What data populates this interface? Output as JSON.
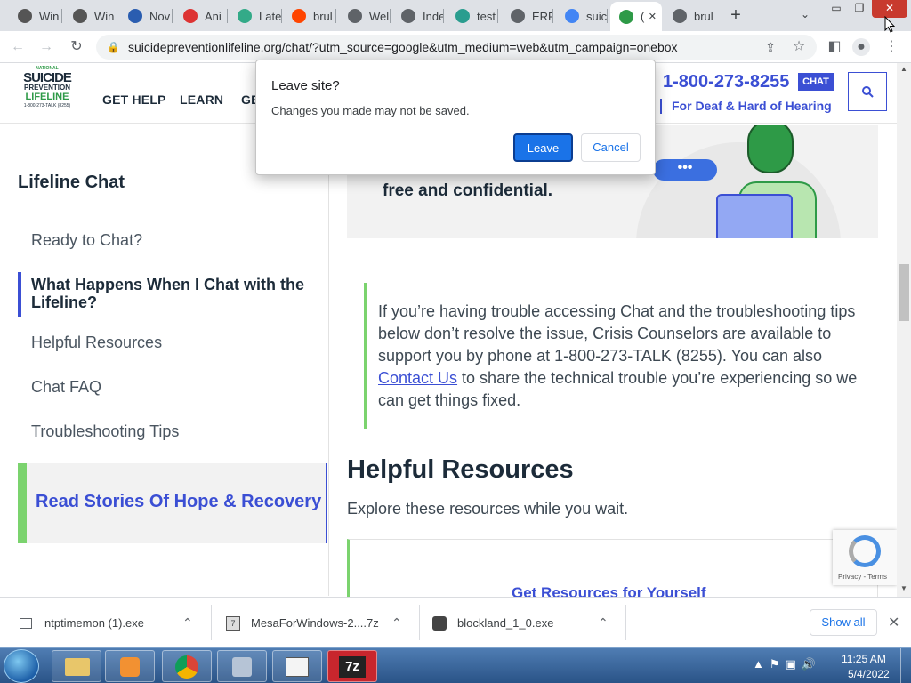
{
  "tabs": [
    {
      "label": "Win",
      "icon": "s-icon",
      "color": "#555"
    },
    {
      "label": "Win",
      "icon": "s-icon",
      "color": "#555"
    },
    {
      "label": "Nov",
      "icon": "circle-icon",
      "color": "#2a5db0"
    },
    {
      "label": "Ani",
      "icon": "lightning-icon",
      "color": "#d33"
    },
    {
      "label": "Late",
      "icon": "windows-icon",
      "color": "#3a8"
    },
    {
      "label": "brul",
      "icon": "reddit-icon",
      "color": "#ff4500"
    },
    {
      "label": "Wel",
      "icon": "globe-icon",
      "color": "#5f6368"
    },
    {
      "label": "Inde",
      "icon": "globe-icon",
      "color": "#5f6368"
    },
    {
      "label": "test",
      "icon": "t-icon",
      "color": "#2a9d8f"
    },
    {
      "label": "ERR",
      "icon": "globe-icon",
      "color": "#5f6368"
    },
    {
      "label": "suic",
      "icon": "google-icon",
      "color": "#4285f4"
    },
    {
      "label": "(",
      "icon": "lifeline-icon",
      "color": "#2e9a47",
      "active": true
    },
    {
      "label": "brul",
      "icon": "globe-icon",
      "color": "#5f6368"
    }
  ],
  "url": "suicidepreventionlifeline.org/chat/?utm_source=google&utm_medium=web&utm_campaign=onebox",
  "logo": {
    "line1": "NATIONAL",
    "line2": "SUICIDE",
    "line3": "PREVENTION",
    "line4": "LIFELINE",
    "line5": "1-800-273-TALK (8255)"
  },
  "nav": {
    "get_help": "GET HELP",
    "learn": "LEARN",
    "partial": "GE"
  },
  "phone": "1-800-273-8255",
  "chat_badge": "CHAT",
  "deaf_link": "For Deaf & Hard of Hearing",
  "sidebar": {
    "title": "Lifeline Chat",
    "items": [
      "Ready to Chat?",
      "What Happens When I Chat with the Lifeline?",
      "Helpful Resources",
      "Chat FAQ",
      "Troubleshooting Tips"
    ],
    "stories": "Read Stories Of Hope & Recovery"
  },
  "main": {
    "banner_text": "free and confidential.",
    "callout_pre": "If you’re having trouble accessing Chat and the troubleshooting tips below don’t resolve the issue, Crisis Counselors are available to support you by phone at 1-800-273-TALK (8255). You can also ",
    "callout_link": "Contact Us",
    "callout_post": " to share the technical trouble you’re experiencing so we can get things fixed.",
    "resources_title": "Helpful Resources",
    "resources_sub": "Explore these resources while you wait.",
    "card_title": "Get Resources for Yourself"
  },
  "recaptcha": {
    "text": "Privacy - Terms"
  },
  "dialog": {
    "title": "Leave site?",
    "message": "Changes you made may not be saved.",
    "leave": "Leave",
    "cancel": "Cancel"
  },
  "downloads": {
    "items": [
      "ntptimemon (1).exe",
      "MesaForWindows-2....7z",
      "blockland_1_0.exe"
    ],
    "show_all": "Show all"
  },
  "clock": {
    "time": "11:25 AM",
    "date": "5/4/2022"
  },
  "colors": {
    "brand_green": "#2e9a47",
    "brand_blue": "#3b4fd4",
    "chrome_blue": "#1a73e8"
  }
}
